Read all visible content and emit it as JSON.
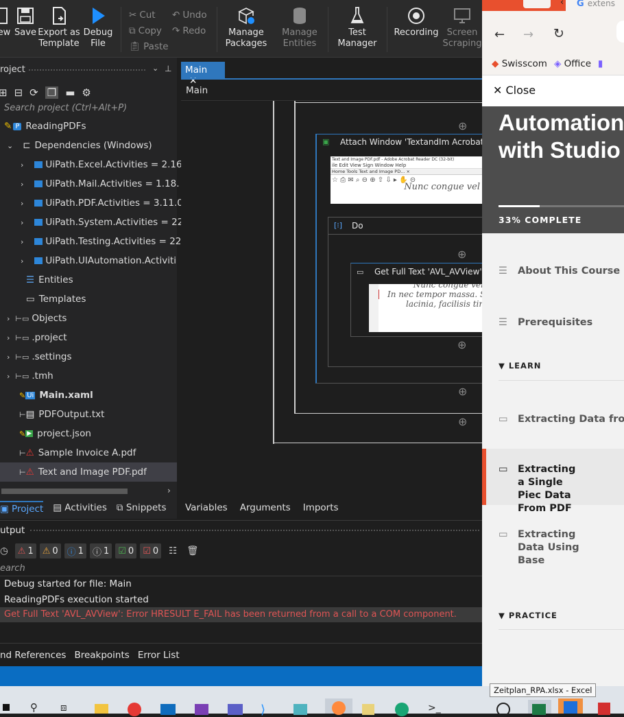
{
  "ribbon": {
    "new_label": "ew",
    "save_label": "Save",
    "export_label": "Export as\nTemplate",
    "debug_label": "Debug\nFile",
    "cut_label": "Cut",
    "copy_label": "Copy",
    "paste_label": "Paste",
    "undo_label": "Undo",
    "redo_label": "Redo",
    "manage_packages_label": "Manage\nPackages",
    "manage_entities_label": "Manage\nEntities",
    "test_manager_label": "Test\nManager",
    "recording_label": "Recording",
    "screen_scraping_label": "Screen\nScraping"
  },
  "project_panel": {
    "title": "roject",
    "search_placeholder": "Search project (Ctrl+Alt+P)",
    "root": "ReadingPDFs",
    "dependencies": "Dependencies (Windows)",
    "packages": [
      "UiPath.Excel.Activities = 2.16.",
      "UiPath.Mail.Activities = 1.18.",
      "UiPath.PDF.Activities = 3.11.0",
      "UiPath.System.Activities = 22",
      "UiPath.Testing.Activities = 22",
      "UiPath.UIAutomation.Activiti"
    ],
    "entities": "Entities",
    "templates": "Templates",
    "folders": [
      "Objects",
      ".project",
      ".settings",
      ".tmh"
    ],
    "files": [
      "Main.xaml",
      "PDFOutput.txt",
      "project.json",
      "Sample Invoice A.pdf",
      "Text and Image PDF.pdf"
    ],
    "tabs": [
      "Project",
      "Activities",
      "Snippets"
    ]
  },
  "designer": {
    "tab_label": "Main",
    "breadcrumb": "Main",
    "attach_window": "Attach Window 'TextandIm Acrobatsd'",
    "do_label": "Do",
    "get_full_text": "Get Full Text 'AVL_AVView'",
    "preview_text_1": "Nunc congue vel",
    "preview_text_2": "In nec tempor massa. Sed",
    "preview_text_3": "lacinia, facilisis tinc",
    "acrobat_title": "Text and Image PDF.pdf - Adobe Acrobat Reader DC (32-bit)",
    "acrobat_menu": "ile  Edit  View  Sign  Window  Help",
    "acrobat_tabs": "Home    Tools       Text and Image PD... ×",
    "bottom_tabs": [
      "Variables",
      "Arguments",
      "Imports"
    ]
  },
  "output": {
    "title": "utput",
    "counts": {
      "error": "1",
      "warning": "0",
      "info": "1",
      "trace": "1",
      "success": "0",
      "failed": "0"
    },
    "search_placeholder": "earch",
    "lines": [
      "Debug started for file: Main",
      "ReadingPDFs execution started"
    ],
    "error_line": "Get Full Text 'AVL_AVView': Error HRESULT E_FAIL has been returned from a call to a COM component.",
    "bottom_tabs": [
      "nd References",
      "Breakpoints",
      "Error List"
    ]
  },
  "browser": {
    "tab_text": "extens",
    "bookmarks": [
      "Swisscom",
      "Office"
    ],
    "close_label": "Close",
    "course_title": "Automation with Studio",
    "progress_label": "33% COMPLETE",
    "progress_fraction": 0.33,
    "items": [
      "About This Course",
      "Prerequisites"
    ],
    "section_learn": "LEARN",
    "lessons": [
      "Extracting Data from P",
      "Extracting a Single Piec Data From PDF",
      "Extracting Data Using Base"
    ],
    "section_practice": "PRACTICE"
  },
  "taskbar": {
    "tooltip": "Zeitplan_RPA.xlsx - Excel"
  },
  "colors": {
    "accent": "#2f77bd",
    "error": "#e05555",
    "browser_accent": "#e8502e",
    "status_blue": "#0a6dc2"
  }
}
